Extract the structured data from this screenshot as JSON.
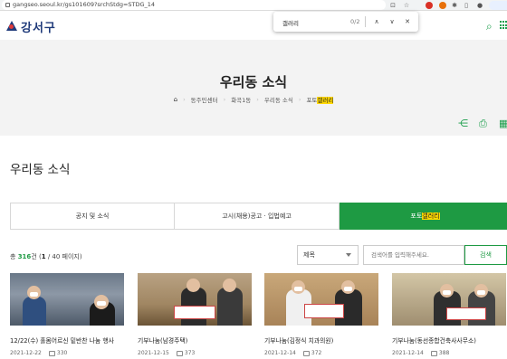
{
  "browser": {
    "url": "gangseo.seoul.kr/gs101609?srchStdg=STDG_14"
  },
  "findbar": {
    "query": "갤러리",
    "count": "0/2",
    "prev": "∧",
    "next": "∨",
    "close": "✕"
  },
  "header": {
    "logo_text": "강서구"
  },
  "hero": {
    "title": "우리동 소식",
    "breadcrumb": [
      "동주민센터",
      "화곡1동",
      "우리동 소식"
    ],
    "current_prefix": "포토",
    "current_highlight": "갤러리"
  },
  "section": {
    "title": "우리동 소식"
  },
  "tabs": [
    {
      "label": "공지 및 소식"
    },
    {
      "label": "고시(채용)공고 · 입법예고"
    },
    {
      "prefix": "포토",
      "highlight": "갤러리"
    }
  ],
  "listing": {
    "total_prefix": "총",
    "total_count": "316",
    "total_suffix": "건 (",
    "page_current": "1",
    "page_rest": " / 40 페이지)"
  },
  "search": {
    "select_value": "제목",
    "placeholder": "검색어를 입력해주세요.",
    "button_label": "검색"
  },
  "gallery": [
    {
      "title": "12/22(수) 홀몸어르신 밑반찬 나눔 행사",
      "date": "2021-12-22",
      "views": "330"
    },
    {
      "title": "기부나눔(남경주택)",
      "date": "2021-12-15",
      "views": "373"
    },
    {
      "title": "기부나눔(김정식 치과의원)",
      "date": "2021-12-14",
      "views": "372"
    },
    {
      "title": "기부나눔(동선종합건축사사무소)",
      "date": "2021-12-14",
      "views": "388"
    }
  ],
  "colors": {
    "accent": "#1e9a43",
    "highlight": "#ffd800",
    "logo": "#1f3a7a"
  }
}
